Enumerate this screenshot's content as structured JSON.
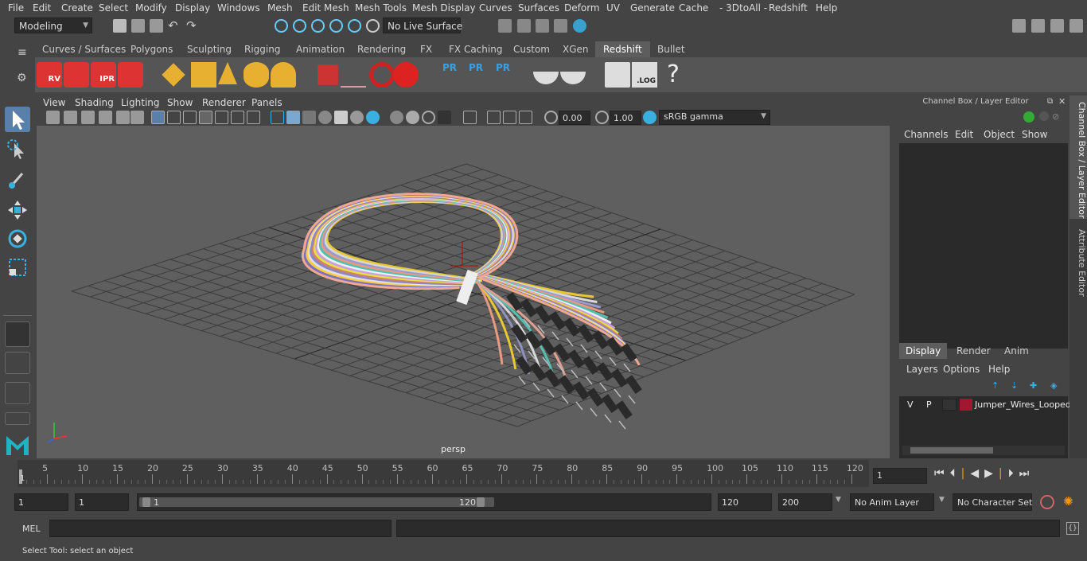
{
  "menubar": {
    "items": [
      "File",
      "Edit",
      "Create",
      "Select",
      "Modify",
      "Display",
      "Windows",
      "Mesh",
      "Edit Mesh",
      "Mesh Tools",
      "Mesh Display",
      "Curves",
      "Surfaces",
      "Deform",
      "UV",
      "Generate",
      "Cache",
      "- 3DtoAll -",
      "Redshift",
      "Help"
    ]
  },
  "statusline": {
    "mode": "Modeling",
    "live_surface": "No Live Surface"
  },
  "shelf": {
    "tabs": [
      "Curves / Surfaces",
      "Polygons",
      "Sculpting",
      "Rigging",
      "Animation",
      "Rendering",
      "FX",
      "FX Caching",
      "Custom",
      "XGen",
      "Redshift",
      "Bullet"
    ],
    "active_tab": "Redshift",
    "icon_labels": {
      "rv": "RV",
      "ipr": "IPR",
      "pr": "PR",
      "log": ".LOG",
      "help": "?"
    }
  },
  "viewport": {
    "menu": [
      "View",
      "Shading",
      "Lighting",
      "Show",
      "Renderer",
      "Panels"
    ],
    "exposure": "0.00",
    "gamma": "1.00",
    "color_space": "sRGB gamma",
    "camera_label": "persp"
  },
  "channel_box": {
    "title": "Channel Box / Layer Editor",
    "menu": [
      "Channels",
      "Edit",
      "Object",
      "Show"
    ],
    "layer_tabs": [
      "Display",
      "Render",
      "Anim"
    ],
    "active_layer_tab": "Display",
    "layer_menu": [
      "Layers",
      "Options",
      "Help"
    ],
    "layer": {
      "v": "V",
      "p": "P",
      "name": "Jumper_Wires_Looped",
      "color": "#a01830"
    }
  },
  "side_tabs": [
    "Channel Box / Layer Editor",
    "Attribute Editor"
  ],
  "timeline": {
    "ticks": [
      5,
      10,
      15,
      20,
      25,
      30,
      35,
      40,
      45,
      50,
      55,
      60,
      65,
      70,
      75,
      80,
      85,
      90,
      95,
      100,
      105,
      110,
      115,
      120
    ],
    "current_frame": "1",
    "start_marker": "1"
  },
  "range": {
    "start": "1",
    "playback_start": "1",
    "slider_start": "1",
    "slider_end": "120",
    "playback_end": "120",
    "end": "200",
    "anim_layer": "No Anim Layer",
    "character_set": "No Character Set"
  },
  "mel": {
    "label": "MEL"
  },
  "help_line": "Select Tool: select an object"
}
